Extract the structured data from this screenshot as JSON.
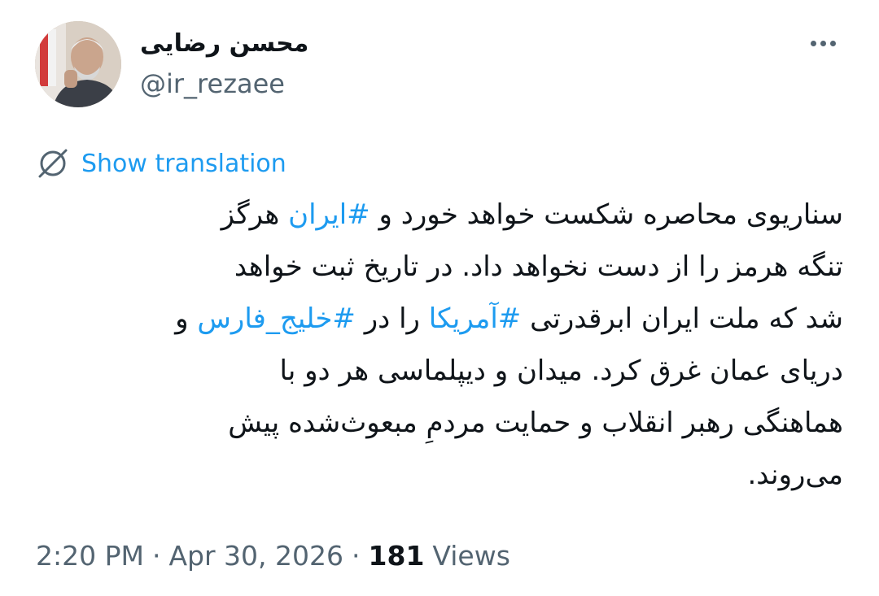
{
  "author": {
    "name": "محسن رضایی",
    "handle": "@ir_rezaee"
  },
  "translate": {
    "label": "Show translation",
    "icon": "globe-strike-icon"
  },
  "tweet": {
    "line1_a": "سناریوی محاصره شکست خواهد خورد و ",
    "line1_tag": "#ایران",
    "line1_b": " هرگز",
    "line2": "تنگه هرمز را از دست نخواهد داد. در تاریخ ثبت خواهد",
    "line3_a": "شد که ملت ایران ابرقدرتی ",
    "line3_tag1": "#آمریکا",
    "line3_b": " را در ",
    "line3_tag2": "#خلیج_فارس",
    "line3_c": " و",
    "line4": "دریای عمان غرق کرد. میدان و دیپلماسی هر دو با",
    "line5": "هماهنگی رهبر انقلاب و حمایت مردمِ مبعوث‌شده پیش",
    "line6": "می‌روند."
  },
  "meta": {
    "time": "2:20 PM",
    "date": "Apr 30, 2026",
    "views_count": "181",
    "views_label": "Views",
    "separator": "·"
  },
  "colors": {
    "accent": "#1d9bf0",
    "text": "#0f1419",
    "muted": "#536471"
  }
}
